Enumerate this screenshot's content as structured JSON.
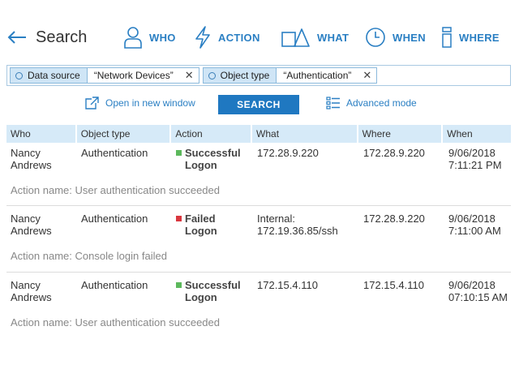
{
  "header": {
    "back_title": "Search",
    "nav": [
      {
        "label": "WHO",
        "icon": "person-icon"
      },
      {
        "label": "ACTION",
        "icon": "lightning-icon"
      },
      {
        "label": "WHAT",
        "icon": "objects-icon"
      },
      {
        "label": "WHEN",
        "icon": "clock-icon"
      },
      {
        "label": "WHERE",
        "icon": "server-icon"
      }
    ]
  },
  "filters": [
    {
      "key": "Data source",
      "value": "“Network Devices”"
    },
    {
      "key": "Object type",
      "value": "“Authentication”"
    }
  ],
  "toolbar": {
    "open_new_window": "Open in new window",
    "search_label": "SEARCH",
    "advanced_mode": "Advanced mode"
  },
  "table": {
    "columns": [
      "Who",
      "Object type",
      "Action",
      "What",
      "Where",
      "When"
    ],
    "rows": [
      {
        "who": "Nancy\nAndrews",
        "object_type": "Authentication",
        "action": "Successful\nLogon",
        "status": "success",
        "what": "172.28.9.220",
        "where": "172.28.9.220",
        "when": "9/06/2018\n7:11:21 PM",
        "action_name": "Action name: User authentication succeeded"
      },
      {
        "who": "Nancy\nAndrews",
        "object_type": "Authentication",
        "action": "Failed\nLogon",
        "status": "failed",
        "what": "Internal:\n172.19.36.85/ssh",
        "where": "172.28.9.220",
        "when": "9/06/2018\n7:11:00 AM",
        "action_name": "Action name: Console login failed"
      },
      {
        "who": "Nancy\nAndrews",
        "object_type": "Authentication",
        "action": "Successful\nLogon",
        "status": "success",
        "what": "172.15.4.110",
        "where": "172.15.4.110",
        "when": "9/06/2018\n07:10:15 AM",
        "action_name": "Action name: User authentication succeeded"
      }
    ]
  },
  "colors": {
    "accent": "#2a7fc3",
    "button": "#1f78c1",
    "header_bg": "#d6eaf8",
    "success": "#5cb85c",
    "failed": "#d9363e"
  }
}
